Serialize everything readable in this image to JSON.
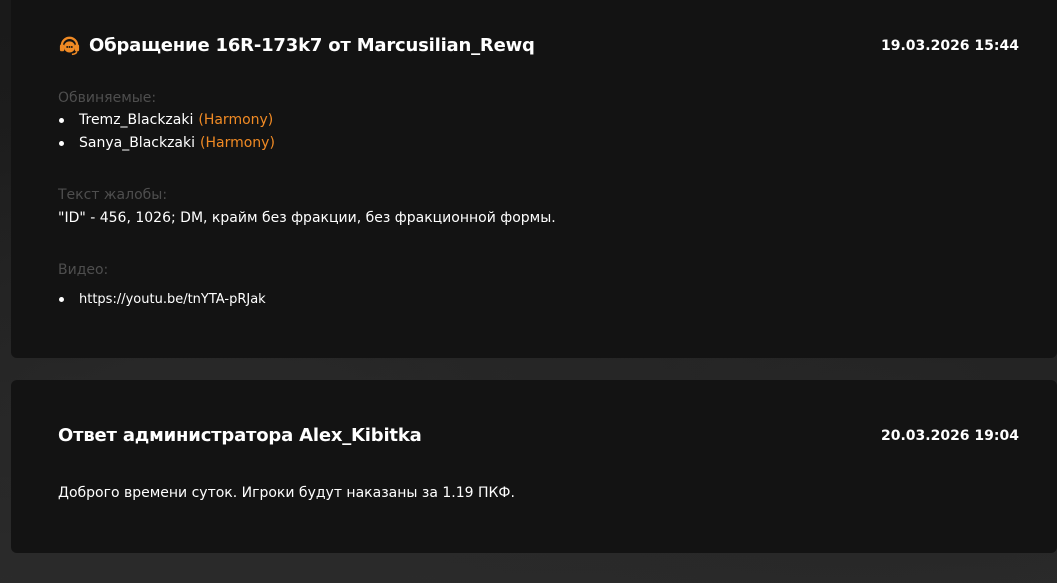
{
  "complaint": {
    "title": "Обращение 16R-173k7 от Marcusilian_Rewq",
    "datetime": "19.03.2026 15:44",
    "icon": "support-headset-icon",
    "accent_color": "#f08a24",
    "accused_label": "Обвиняемые:",
    "accused": [
      {
        "name": "Tremz_Blackzaki",
        "faction": "(Harmony)"
      },
      {
        "name": "Sanya_Blackzaki",
        "faction": "(Harmony)"
      }
    ],
    "text_label": "Текст жалобы:",
    "text": "\"ID\" - 456, 1026; DM, крайм без фракции, без фракционной формы.",
    "video_label": "Видео:",
    "videos": [
      "https://youtu.be/tnYTA-pRJak"
    ]
  },
  "answer": {
    "title": "Ответ администратора Alex_Kibitka",
    "datetime": "20.03.2026 19:04",
    "text": "Доброго времени суток. Игроки будут наказаны за 1.19 ПКФ."
  }
}
